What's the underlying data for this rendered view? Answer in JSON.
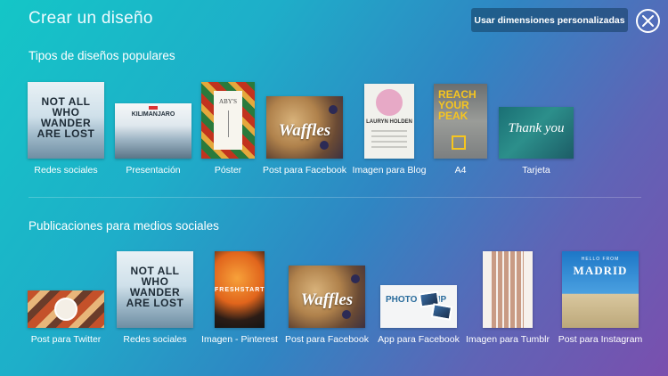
{
  "header": {
    "title": "Crear un diseño",
    "custom_dimensions_label": "Usar dimensiones personalizadas"
  },
  "popular": {
    "title": "Tipos de diseños populares",
    "items": [
      {
        "label": "Redes sociales",
        "thumb_text": "NOT ALL WHO WANDER ARE LOST"
      },
      {
        "label": "Presentación",
        "thumb_text": "KILIMANJARO"
      },
      {
        "label": "Póster",
        "thumb_text": "ABY'S"
      },
      {
        "label": "Post para Facebook",
        "thumb_text": "Waffles"
      },
      {
        "label": "Imagen para Blog",
        "thumb_text": "LAURYN HOLDEN"
      },
      {
        "label": "A4",
        "thumb_text": "REACH YOUR PEAK"
      },
      {
        "label": "Tarjeta",
        "thumb_text": "Thank you"
      }
    ]
  },
  "social": {
    "title": "Publicaciones para medios sociales",
    "items": [
      {
        "label": "Post para Twitter",
        "thumb_text": ""
      },
      {
        "label": "Redes sociales",
        "thumb_text": "NOT ALL WHO WANDER ARE LOST"
      },
      {
        "label": "Imagen - Pinterest",
        "thumb_text": "FRESHSTART"
      },
      {
        "label": "Post para Facebook",
        "thumb_text": "Waffles"
      },
      {
        "label": "App para Facebook",
        "thumb_text": "PHOTO COMP"
      },
      {
        "label": "Imagen para Tumblr",
        "thumb_text": ""
      },
      {
        "label": "Post para Instagram",
        "thumb_text": "MADRID",
        "thumb_small": "HELLO FROM"
      }
    ]
  }
}
